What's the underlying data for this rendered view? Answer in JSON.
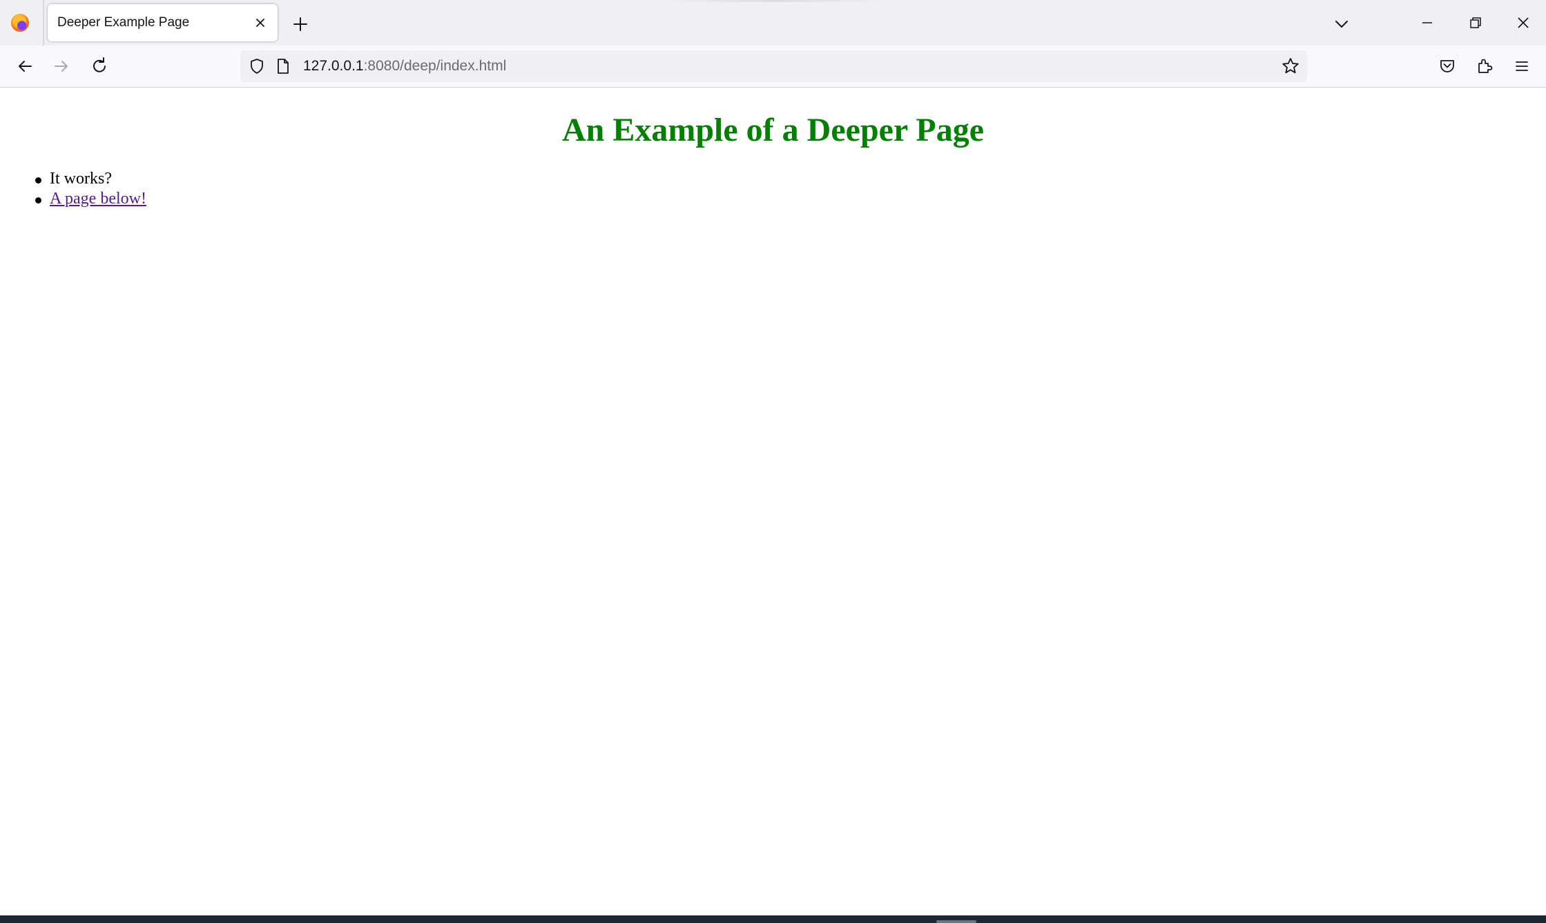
{
  "browser": {
    "tab": {
      "title": "Deeper Example Page"
    },
    "url": {
      "host": "127.0.0.1",
      "rest": ":8080/deep/index.html"
    }
  },
  "page": {
    "heading": "An Example of a Deeper Page",
    "items": [
      {
        "text": "It works?",
        "is_link": false
      },
      {
        "text": "A page below!",
        "is_link": true
      }
    ]
  },
  "colors": {
    "heading": "#008000",
    "visited_link": "#551a8b",
    "tabstrip_bg": "#f0f0f4",
    "navbar_bg": "#f9f9fb"
  },
  "icons": [
    "firefox-logo-icon",
    "close-icon",
    "plus-icon",
    "chevron-down-icon",
    "minimize-icon",
    "restore-icon",
    "window-close-icon",
    "back-arrow-icon",
    "forward-arrow-icon",
    "reload-icon",
    "shield-icon",
    "page-icon",
    "star-icon",
    "pocket-icon",
    "extensions-icon",
    "menu-icon"
  ]
}
